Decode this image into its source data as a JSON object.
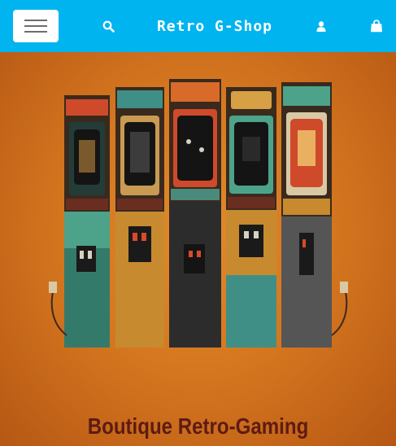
{
  "navbar": {
    "menu_icon": "hamburger-menu-icon",
    "search_icon": "search-icon",
    "brand": "Retro G-Shop",
    "account_icon": "user-icon",
    "cart_icon": "shopping-bag-icon",
    "background_color": "#00b4f0"
  },
  "hero": {
    "image_icon": "arcade-cabinets-illustration",
    "title": "Boutique Retro-Gaming",
    "background_color": "#d5761e",
    "title_color": "#5e1b12"
  }
}
